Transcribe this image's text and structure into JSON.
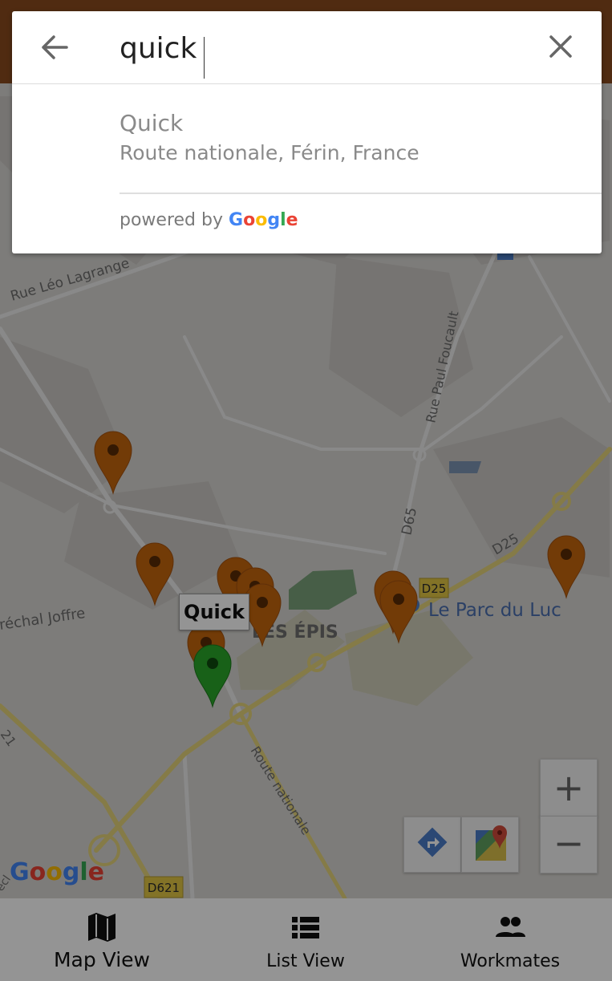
{
  "search": {
    "query": "quick",
    "back_icon": "arrow-left-icon",
    "clear_icon": "close-icon"
  },
  "suggestions": [
    {
      "title": "Quick",
      "subtitle": "Route nationale, Férin, France"
    }
  ],
  "attribution": {
    "powered_by": "powered by",
    "google": [
      "G",
      "o",
      "o",
      "g",
      "l",
      "e"
    ],
    "google_colors": [
      "#4285F4",
      "#EA4335",
      "#FBBC05",
      "#4285F4",
      "#34A853",
      "#EA4335"
    ]
  },
  "map": {
    "road_labels": {
      "rue_leo": "Rue Léo Lagrange",
      "rue_paul": "Rue Paul Foucault",
      "d65": "D65",
      "d25": "D25",
      "d25_shield": "D25",
      "marechal": "réchal Joffre",
      "route_nat": "Route nationale",
      "d621": "D621",
      "partial_21": "21",
      "partial_eci": "ecl"
    },
    "place_labels": {
      "les_epis": "LES ÉPIS",
      "parc_du_luc": "Le Parc du Luc"
    },
    "selected_marker_label": "Quick",
    "marker_color": "#c4660d",
    "selected_marker_color": "#2aa82a"
  },
  "controls": {
    "zoom_in": "+",
    "zoom_out": "−",
    "directions_icon": "directions-icon",
    "google_maps_icon": "google-maps-icon"
  },
  "bottom_nav": {
    "map_view": "Map View",
    "list_view": "List View",
    "workmates": "Workmates"
  }
}
